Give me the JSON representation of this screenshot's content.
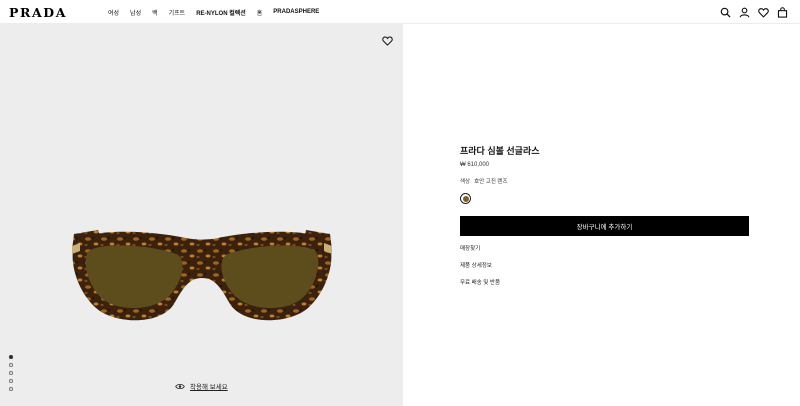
{
  "header": {
    "logo": "PRADA",
    "nav": [
      "여성",
      "남성",
      "백",
      "기프트",
      "RE-NYLON 컬렉션",
      "홈",
      "PRADASPHERE"
    ],
    "icons": [
      "search-icon",
      "account-icon",
      "heart-icon",
      "bag-icon"
    ]
  },
  "gallery": {
    "wishlist_icon": "heart-icon",
    "dots_total": 5,
    "active_dot": 0,
    "try_on_label": "착용해 보세요",
    "try_on_icon": "eye-icon",
    "frame_color": "#3a220f",
    "lens_color": "#5e4d1c"
  },
  "product": {
    "name": "프라다 심볼 선글라스",
    "price": "₩ 610,000",
    "color_label": "색상",
    "color_value": "호안 고진 렌즈",
    "swatch_color": "#7a6028",
    "add_to_cart": "장바구니에 추가하기",
    "links": [
      "매장찾기",
      "제품 상세정보",
      "무료 배송 및 반품"
    ]
  }
}
